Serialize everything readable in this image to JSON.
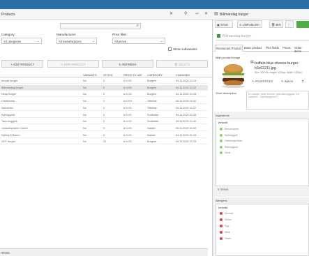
{
  "products_panel": {
    "title": "Products",
    "toolbar_icons": [
      "close-icon",
      "pin-icon",
      "collapse-icon",
      "close-icon"
    ],
    "category_label": "Category:",
    "category_value": "All categories",
    "manufacturer_label": "Manufacturer:",
    "manufacturer_value": "All manufacturers",
    "price_filter_label": "Price filter:",
    "price_filter_value": "All prices",
    "show_subvariants": "Show subvariants",
    "buttons": {
      "add": "ADD PRODUCT",
      "edit": "EDIT PRODUCT",
      "refresh": "REFRESH",
      "delete": "DELETE"
    },
    "columns": [
      "",
      "VARIANTS",
      "STOCK",
      "PRICE EX VAT",
      "CATEGORY",
      "CHANGED"
    ],
    "rows": [
      [
        "Amper burger",
        "No",
        "0",
        "kr 0,00",
        "Burgere",
        "04.11.2020 21:19"
      ],
      [
        "Blåmandag burger",
        "No",
        "0",
        "kr 0,00",
        "Burgere",
        "04.11.2020 21:22"
      ],
      [
        "Heap Burger",
        "No",
        "0",
        "kr 0,00",
        "Burgere",
        "04.11.2020 21:25"
      ],
      [
        "Chickbenar",
        "No",
        "0",
        "kr 0,00",
        "Tilbehør",
        "04.11.2020 21:31"
      ],
      [
        "Idahofries",
        "No",
        "0",
        "kr 0,00",
        "Tilbehør",
        "04.11.2020 21:37"
      ],
      [
        "Kyllingspett",
        "No",
        "0",
        "kr 0,00",
        "Småretter",
        "04.11.2020 21:39"
      ],
      [
        "Taco nuggets",
        "No",
        "0",
        "kr 0,00",
        "Småretter",
        "04.11.2020 21:40"
      ],
      [
        "Jordbærpisterm Clarer",
        "No",
        "0",
        "kr 0,00",
        "Salater",
        "04.11.2020 21:42"
      ],
      [
        "Kylling & Bacon",
        "No",
        "0",
        "kr 0,00",
        "Salater",
        "04.11.2020 21:43"
      ],
      [
        "NOT burger",
        "No",
        "22",
        "kr 0,00",
        "Burgere",
        "04.11.2020 21:43"
      ]
    ],
    "footer_text": "ITEMS"
  },
  "detail_panel": {
    "title": "Blåmandag burger",
    "toolbar": {
      "save": "SAVE",
      "unpublish": "UNPUBLISH",
      "bin": "BIN"
    },
    "product_name": "Blåmandag burger",
    "tabs": [
      "Restaurant Product",
      "Basic product",
      "Flex fields",
      "Prices",
      "Order items"
    ],
    "main_image_label": "Main product image",
    "file_name": "buffalo-blue-cheese-burger-b3c02211.jpg",
    "file_meta": "Size: 200 KB, Height: 1200px, Width: 1200px",
    "image_buttons": {
      "properties": "PROPERTIES",
      "image": "IMAGE"
    },
    "short_desc_label": "Short description",
    "short_desc_value": "En burger med mixene grill blåmuggost. En sukulen... hamburgeren i",
    "ingredients_label": "Ingredients",
    "ingredients_header": "Innhold",
    "ingredients": [
      "Bacontopper",
      "Syltelaggrill",
      "Hamburgerbrød",
      "Blåmuggost",
      "Salat"
    ],
    "ingredients_count": "5 ITEMS",
    "allergens_label": "Allergens",
    "allergens_header": "Innhold",
    "allergens": [
      "Sennep",
      "Selleri",
      "Egg",
      "Melk",
      "Hvete"
    ]
  },
  "colors": {
    "topbar": "#2a6fa8",
    "accent_green": "#4fae43",
    "allergen_red": "#e03a3a",
    "ingredient_green": "#8fd36f"
  }
}
